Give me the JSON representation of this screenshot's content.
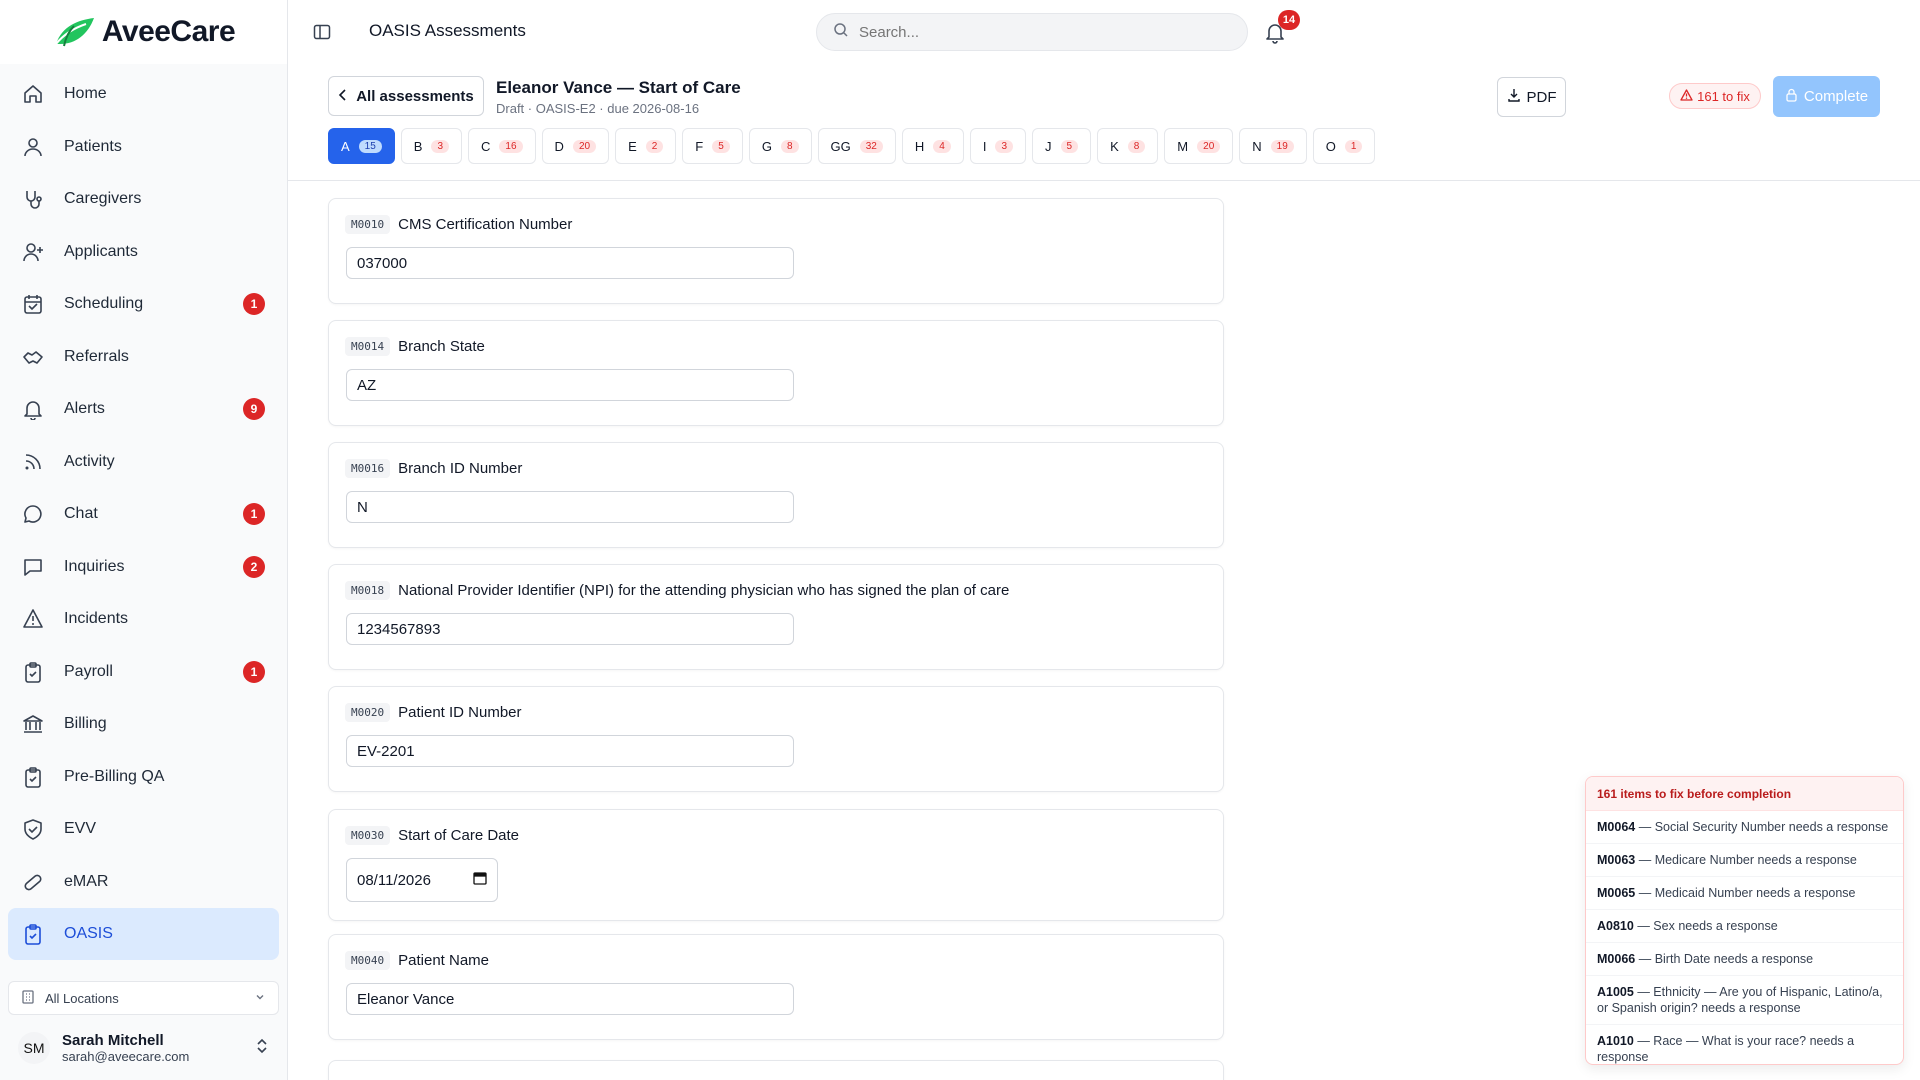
{
  "app": {
    "name": "AveeCare"
  },
  "sidebar": {
    "items": [
      {
        "label": "Home",
        "icon": "home-icon",
        "badge": ""
      },
      {
        "label": "Patients",
        "icon": "user-icon",
        "badge": ""
      },
      {
        "label": "Caregivers",
        "icon": "stethoscope-icon",
        "badge": ""
      },
      {
        "label": "Applicants",
        "icon": "user-plus-icon",
        "badge": ""
      },
      {
        "label": "Scheduling",
        "icon": "calendar-icon",
        "badge": "1"
      },
      {
        "label": "Referrals",
        "icon": "handshake-icon",
        "badge": ""
      },
      {
        "label": "Alerts",
        "icon": "bell-icon",
        "badge": "9"
      },
      {
        "label": "Activity",
        "icon": "rss-icon",
        "badge": ""
      },
      {
        "label": "Chat",
        "icon": "chat-icon",
        "badge": "1"
      },
      {
        "label": "Inquiries",
        "icon": "message-square-icon",
        "badge": "2"
      },
      {
        "label": "Incidents",
        "icon": "warning-icon",
        "badge": ""
      },
      {
        "label": "Payroll",
        "icon": "clipboard-icon",
        "badge": "1"
      },
      {
        "label": "Billing",
        "icon": "bank-icon",
        "badge": ""
      },
      {
        "label": "Pre-Billing QA",
        "icon": "clipboard-check-icon",
        "badge": ""
      },
      {
        "label": "EVV",
        "icon": "shield-check-icon",
        "badge": ""
      },
      {
        "label": "eMAR",
        "icon": "pill-icon",
        "badge": ""
      },
      {
        "label": "OASIS",
        "icon": "clipboard-check-icon",
        "badge": "",
        "active": true
      }
    ],
    "location": "All Locations",
    "user": {
      "initials": "SM",
      "name": "Sarah Mitchell",
      "email": "sarah@aveecare.com"
    }
  },
  "topbar": {
    "title": "OASIS Assessments",
    "search_placeholder": "Search...",
    "notifications": "14"
  },
  "assessment": {
    "back_label": "All assessments",
    "title": "Eleanor Vance — Start of Care",
    "subtitle": "Draft · OASIS-E2 · due 2026-08-16",
    "pdf_label": "PDF",
    "fix_badge": "161 to fix",
    "complete_label": "Complete"
  },
  "tabs": [
    {
      "label": "A",
      "count": "15",
      "active": true
    },
    {
      "label": "B",
      "count": "3"
    },
    {
      "label": "C",
      "count": "16"
    },
    {
      "label": "D",
      "count": "20"
    },
    {
      "label": "E",
      "count": "2"
    },
    {
      "label": "F",
      "count": "5"
    },
    {
      "label": "G",
      "count": "8"
    },
    {
      "label": "GG",
      "count": "32"
    },
    {
      "label": "H",
      "count": "4"
    },
    {
      "label": "I",
      "count": "3"
    },
    {
      "label": "J",
      "count": "5"
    },
    {
      "label": "K",
      "count": "8"
    },
    {
      "label": "M",
      "count": "20"
    },
    {
      "label": "N",
      "count": "19"
    },
    {
      "label": "O",
      "count": "1"
    }
  ],
  "questions": [
    {
      "code": "M0010",
      "label": "CMS Certification Number",
      "value": "037000",
      "type": "text"
    },
    {
      "code": "M0014",
      "label": "Branch State",
      "value": "AZ",
      "type": "text"
    },
    {
      "code": "M0016",
      "label": "Branch ID Number",
      "value": "N",
      "type": "text"
    },
    {
      "code": "M0018",
      "label": "National Provider Identifier (NPI) for the attending physician who has signed the plan of care",
      "value": "1234567893",
      "type": "text"
    },
    {
      "code": "M0020",
      "label": "Patient ID Number",
      "value": "EV-2201",
      "type": "text"
    },
    {
      "code": "M0030",
      "label": "Start of Care Date",
      "value": "08/11/2026",
      "type": "date"
    },
    {
      "code": "M0040",
      "label": "Patient Name",
      "value": "Eleanor Vance",
      "type": "text"
    }
  ],
  "fix_panel": {
    "title": "161 items to fix before completion",
    "items": [
      {
        "code": "M0064",
        "text": "— Social Security Number needs a response"
      },
      {
        "code": "M0063",
        "text": "— Medicare Number needs a response"
      },
      {
        "code": "M0065",
        "text": "— Medicaid Number needs a response"
      },
      {
        "code": "A0810",
        "text": "— Sex needs a response"
      },
      {
        "code": "M0066",
        "text": "— Birth Date needs a response"
      },
      {
        "code": "A1005",
        "text": "— Ethnicity — Are you of Hispanic, Latino/a, or Spanish origin? needs a response"
      },
      {
        "code": "A1010",
        "text": "— Race — What is your race? needs a response"
      }
    ]
  },
  "colors": {
    "brand": "#16a34a",
    "accent": "#2563eb",
    "danger": "#dc2626"
  }
}
